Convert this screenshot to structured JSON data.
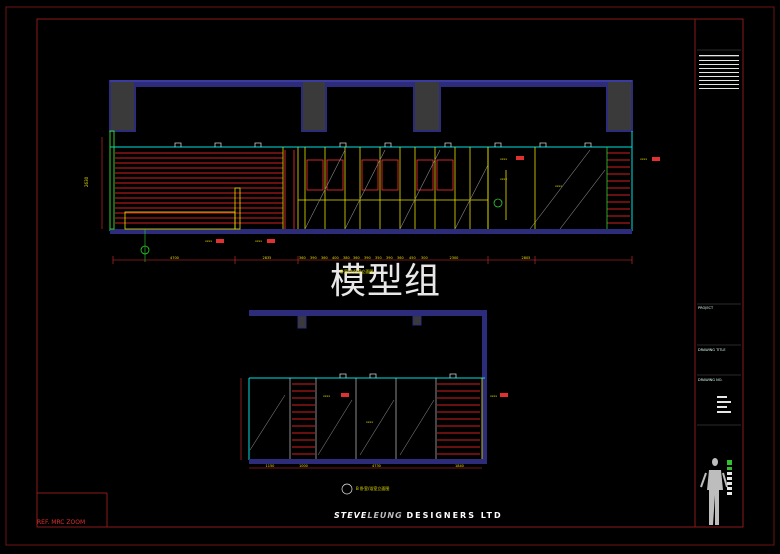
{
  "watermark": "模型组",
  "footer": {
    "brand_a": "STEVE",
    "brand_b": "LEUNG",
    "brand_c": "DESIGNERS LTD",
    "stamp": "REF. MRC ZOOM"
  },
  "drawing": {
    "upper_dims": [
      "4700",
      "2835",
      "360",
      "390",
      "360",
      "400",
      "380",
      "360",
      "390",
      "350",
      "390",
      "360",
      "450",
      "300",
      "2300",
      "2805"
    ],
    "lower_dims": [
      "1150",
      "1000",
      "4730",
      "1840"
    ],
    "upper_title": "卧室/主卧室立面图",
    "lower_title": "B  卧室/浴室立面图",
    "height_dim": "2630",
    "lower_height_dim": "2500"
  },
  "title_block": {
    "project_label": "PROJECT",
    "drawing_title_label": "DRAWING TITLE",
    "drawing_no_label": "DRAWING NO."
  },
  "colors": {
    "frame": "#8a1a1a",
    "ceiling": "#2c2c7a",
    "cyan": "#00e0e0",
    "red": "#ff3030",
    "yellow": "#e8e000",
    "green": "#30e030",
    "white": "#e6e6e6",
    "gray": "#3a3a3a"
  }
}
